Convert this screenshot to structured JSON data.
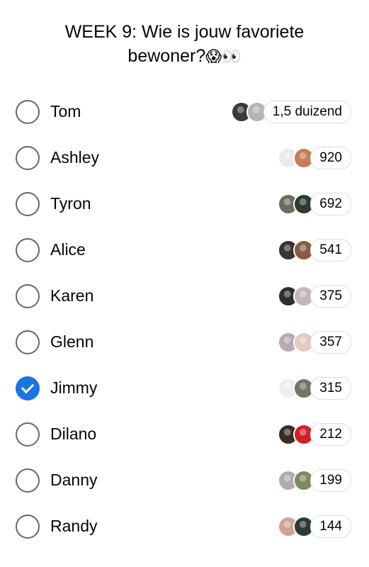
{
  "poll": {
    "title_line1": "WEEK 9: Wie is jouw favoriete",
    "title_line2": "bewoner?",
    "title_emoji": "😱👀",
    "options": [
      {
        "label": "Tom",
        "count": "1,5 duizend",
        "checked": false,
        "avatar_colors": [
          "#3a3a3a",
          "#b9b2b6"
        ]
      },
      {
        "label": "Ashley",
        "count": "920",
        "checked": false,
        "avatar_colors": [
          "#e9eaec",
          "#c77b56"
        ]
      },
      {
        "label": "Tyron",
        "count": "692",
        "checked": false,
        "avatar_colors": [
          "#6d6a5e",
          "#2c3b2e"
        ]
      },
      {
        "label": "Alice",
        "count": "541",
        "checked": false,
        "avatar_colors": [
          "#3b3330",
          "#8a5a44"
        ]
      },
      {
        "label": "Karen",
        "count": "375",
        "checked": false,
        "avatar_colors": [
          "#2f2f2f",
          "#c3b7bb"
        ]
      },
      {
        "label": "Glenn",
        "count": "357",
        "checked": false,
        "avatar_colors": [
          "#b8a9b6",
          "#e5c9bd"
        ]
      },
      {
        "label": "Jimmy",
        "count": "315",
        "checked": true,
        "avatar_colors": [
          "#eceef0",
          "#6f7768"
        ]
      },
      {
        "label": "Dilano",
        "count": "212",
        "checked": false,
        "avatar_colors": [
          "#3b2b22",
          "#d21f28"
        ]
      },
      {
        "label": "Danny",
        "count": "199",
        "checked": false,
        "avatar_colors": [
          "#b5a8b4",
          "#7f8a5c"
        ]
      },
      {
        "label": "Randy",
        "count": "144",
        "checked": false,
        "avatar_colors": [
          "#cfa493",
          "#2e3a36"
        ]
      }
    ]
  },
  "colors": {
    "accent": "#1b74e4",
    "radio_border": "#65676b"
  }
}
